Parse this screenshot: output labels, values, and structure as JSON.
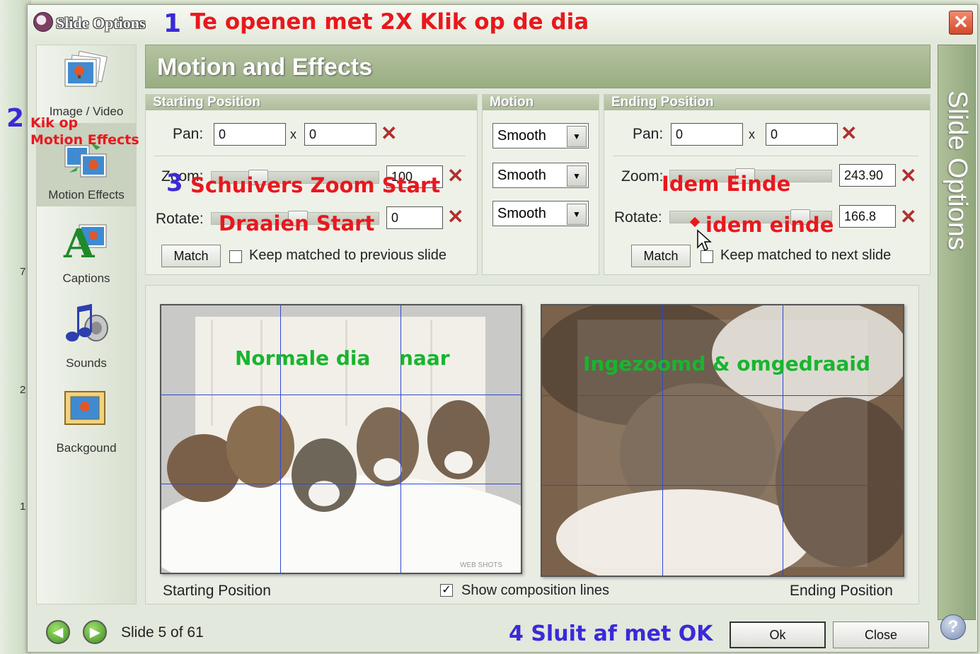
{
  "window": {
    "title": "Slide Options",
    "close_symbol": "✕"
  },
  "background_strip": {
    "numbers": [
      "7",
      "2",
      "1"
    ]
  },
  "annotations": {
    "a1_num": "1",
    "a1_text": "Te openen met 2X Klik op de dia",
    "a2_num": "2",
    "a2_line1": "Kik op",
    "a2_line2": "Motion Effects",
    "a3_num": "3",
    "a3_text": "Schuivers Zoom Start",
    "a3b_text": "Draaien Start",
    "idem_einde_zoom": "Idem Einde",
    "idem_einde_rotate": "idem einde",
    "normale_dia": "Normale dia",
    "naar": "naar",
    "ingezoomd": "Ingezoomd & omgedraaid",
    "a4": "4 Sluit af met OK"
  },
  "sidebar": {
    "items": [
      {
        "label": "Image / Video",
        "icon": "image-video-icon"
      },
      {
        "label": "Motion Effects",
        "icon": "motion-effects-icon"
      },
      {
        "label": "Captions",
        "icon": "captions-icon"
      },
      {
        "label": "Sounds",
        "icon": "sounds-icon"
      },
      {
        "label": "Backgound",
        "icon": "background-icon"
      }
    ]
  },
  "header": {
    "title": "Motion and Effects"
  },
  "right_tab": {
    "label": "Slide Options"
  },
  "start": {
    "title": "Starting Position",
    "pan_label": "Pan:",
    "pan_x": "0",
    "pan_sep": "x",
    "pan_y": "0",
    "zoom_label": "Zoom:",
    "zoom_value": "100",
    "rotate_label": "Rotate:",
    "rotate_value": "0",
    "match_label": "Match",
    "keep_label": "Keep matched to previous slide"
  },
  "motion": {
    "title": "Motion",
    "pan_mode": "Smooth",
    "zoom_mode": "Smooth",
    "rotate_mode": "Smooth"
  },
  "end": {
    "title": "Ending Position",
    "pan_label": "Pan:",
    "pan_x": "0",
    "pan_sep": "x",
    "pan_y": "0",
    "zoom_label": "Zoom:",
    "zoom_value": "243.90",
    "rotate_label": "Rotate:",
    "rotate_value": "166.8",
    "match_label": "Match",
    "keep_label": "Keep matched to next slide"
  },
  "preview": {
    "start_label": "Starting Position",
    "end_label": "Ending Position",
    "show_lines_label": "Show composition lines",
    "show_lines_checked": true,
    "watermark": "WEB SHOTS"
  },
  "footer": {
    "slide_status": "Slide 5 of 61",
    "ok_label": "Ok",
    "close_label": "Close",
    "help_symbol": "?"
  },
  "colors": {
    "accent_header": "#9aae83",
    "grid_lines": "#2f48d4",
    "annotation_red": "#e8181e",
    "annotation_blue": "#3a2ad8",
    "annotation_green": "#18b52e"
  }
}
